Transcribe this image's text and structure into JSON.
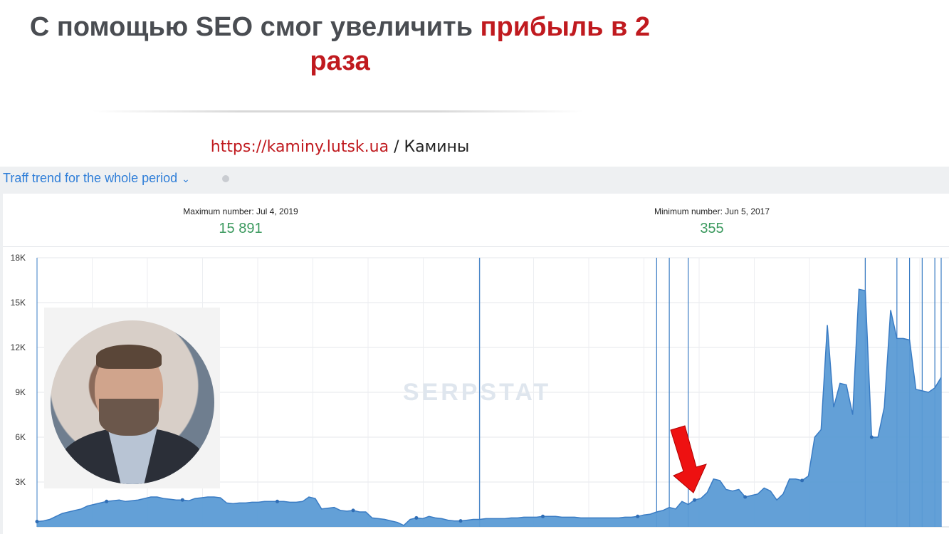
{
  "headline": {
    "prefix": "С помощью SEO смог увеличить ",
    "highlight": "прибыль в 2",
    "line2": "раза"
  },
  "site": {
    "url": "https://kaminy.lutsk.ua",
    "separator": " / ",
    "category": "Камины"
  },
  "panel": {
    "title": "Traff trend for the whole period",
    "chevron_icon": "chevron-down-icon",
    "info_icon": "info-icon"
  },
  "stats": {
    "max_label": "Maximum number: Jul 4, 2019",
    "max_value": "15 891",
    "min_label": "Minimum number: Jun 5, 2017",
    "min_value": "355"
  },
  "watermark": "SERPSTAT",
  "colors": {
    "accent_red": "#c01a1f",
    "series_fill": "#5b9bd5",
    "series_line": "#3a7cc4",
    "value_green": "#3c9a5f",
    "title_blue": "#2f7ed8"
  },
  "chart_data": {
    "type": "area",
    "y_tick_labels": [
      "18K",
      "15K",
      "12K",
      "9K",
      "6K",
      "3K"
    ],
    "y_ticks": [
      18000,
      15000,
      12000,
      9000,
      6000,
      3000
    ],
    "ylim": [
      0,
      18000
    ],
    "x_start_label": "Jun 5, 2017",
    "x_peak_label": "Jul 4, 2019",
    "series": [
      {
        "values": [
          355,
          400,
          500,
          700,
          900,
          1000,
          1100,
          1200,
          1400,
          1500,
          1600,
          1700,
          1750,
          1800,
          1700,
          1750,
          1800,
          1900,
          2000,
          2000,
          1900,
          1850,
          1800,
          1800,
          1750,
          1900,
          1950,
          2000,
          2000,
          1950,
          1600,
          1550,
          1600,
          1600,
          1650,
          1650,
          1700,
          1700,
          1700,
          1700,
          1650,
          1650,
          1700,
          2000,
          1900,
          1200,
          1250,
          1300,
          1100,
          1050,
          1100,
          1000,
          1000,
          600,
          550,
          500,
          400,
          300,
          100,
          500,
          600,
          550,
          700,
          600,
          550,
          450,
          400,
          400,
          450,
          500,
          500,
          550,
          550,
          550,
          550,
          600,
          600,
          650,
          650,
          650,
          700,
          700,
          700,
          650,
          650,
          650,
          600,
          600,
          600,
          600,
          600,
          600,
          600,
          650,
          650,
          700,
          800,
          850,
          1000,
          1100,
          1300,
          1200,
          1700,
          1500,
          1800,
          1900,
          2300,
          3200,
          3100,
          2500,
          2400,
          2500,
          2000,
          2100,
          2200,
          2600,
          2400,
          1800,
          2200,
          3200,
          3200,
          3100,
          3400,
          6000,
          6500,
          13500,
          8000,
          9600,
          9500,
          7500,
          15891,
          15800,
          6000,
          6000,
          8000,
          14500,
          12600,
          12600,
          12500,
          9200,
          9100,
          9000,
          9300,
          10000
        ]
      }
    ],
    "annotation_marker_indices": [
      0,
      11,
      23,
      38,
      50,
      60,
      67,
      80,
      95,
      104,
      112,
      121,
      132,
      146
    ],
    "event_line_indices": [
      70,
      98,
      100,
      103,
      131,
      136,
      138,
      140,
      142,
      143,
      148,
      155
    ]
  }
}
